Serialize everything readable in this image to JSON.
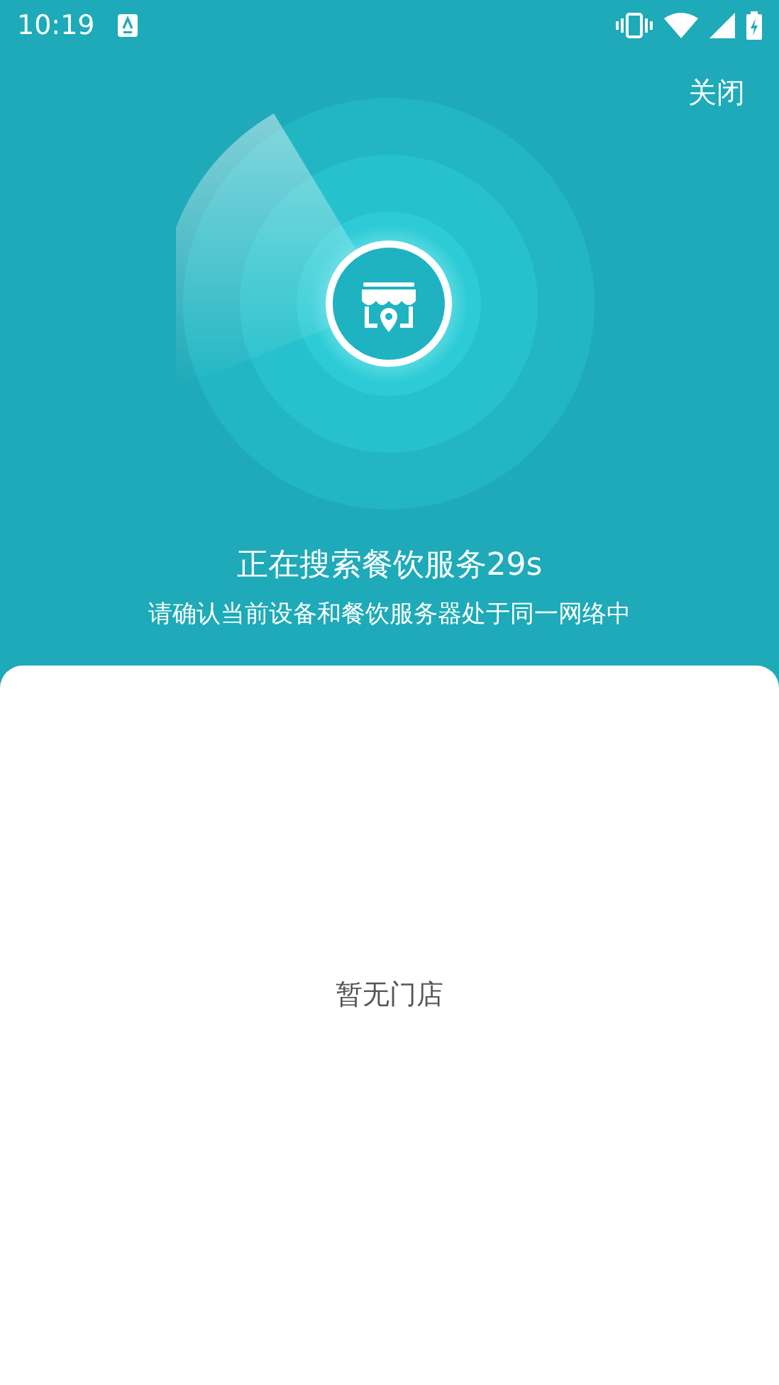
{
  "status_bar": {
    "time": "10:19"
  },
  "header": {
    "close": "关闭"
  },
  "search": {
    "title": "正在搜索餐饮服务29s",
    "subtitle": "请确认当前设备和餐饮服务器处于同一网络中"
  },
  "stores": {
    "empty_text": "暂无门店"
  }
}
